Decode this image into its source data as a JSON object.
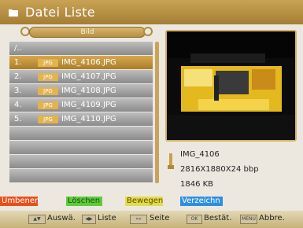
{
  "window": {
    "title": "Datei Liste"
  },
  "category": {
    "label": "Bild"
  },
  "file_list": {
    "parent": "/..",
    "rows": [
      {
        "num": "1.",
        "badge": "JPG",
        "name": "IMG_4106.JPG",
        "selected": true
      },
      {
        "num": "2.",
        "badge": "JPG",
        "name": "IMG_4107.JPG"
      },
      {
        "num": "3.",
        "badge": "JPG",
        "name": "IMG_4108.JPG"
      },
      {
        "num": "4.",
        "badge": "JPG",
        "name": "IMG_4109.JPG"
      },
      {
        "num": "5.",
        "badge": "JPG",
        "name": "IMG_4110.JPG"
      }
    ]
  },
  "info": {
    "name": "IMG_4106",
    "dimensions": "2816X1880X24 bbp",
    "size": "1846 KB"
  },
  "function_buttons": {
    "red": "Umbenen",
    "green": "Löschen",
    "yellow": "Bewegen",
    "blue": "Verzeichn"
  },
  "hints": {
    "select": "Auswä.",
    "list": "Liste",
    "page": "Seite",
    "confirm": "Bestät.",
    "cancel": "Abbre."
  },
  "keys": {
    "updown": "▲▼",
    "leftright": "◀▶",
    "page": "«»",
    "ok": "OK",
    "menu": "MENU"
  },
  "colors": {
    "header": "#b68f44",
    "selected_row": "#c8973d",
    "red": "#e8501c",
    "green": "#5ecb3a",
    "yellow": "#e3dc4a",
    "blue": "#2e8fe0"
  }
}
